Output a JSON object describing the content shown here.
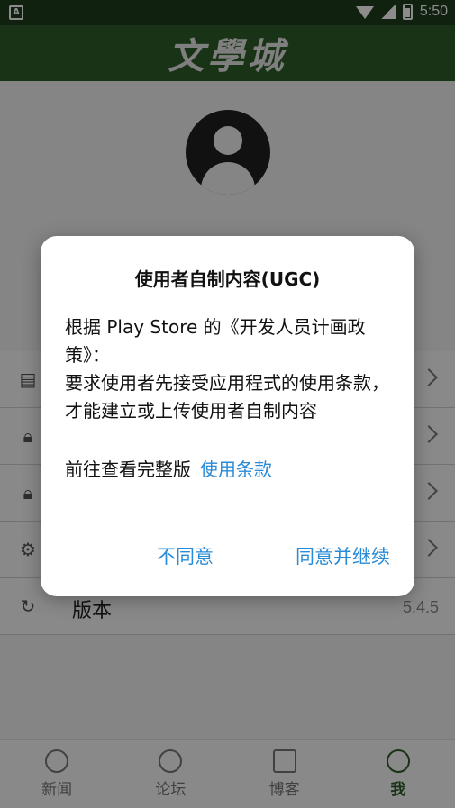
{
  "status_bar": {
    "time": "5:50",
    "left_icon": "A"
  },
  "app_bar": {
    "title": "文學城"
  },
  "menu": {
    "version_label": "版本",
    "version_value": "5.4.5"
  },
  "bottom_nav": {
    "items": [
      {
        "label": "新闻",
        "icon": "globe-icon"
      },
      {
        "label": "论坛",
        "icon": "chat-icon"
      },
      {
        "label": "博客",
        "icon": "newspaper-icon"
      },
      {
        "label": "我",
        "icon": "profile-icon"
      }
    ]
  },
  "dialog": {
    "title": "使用者自制内容(UGC)",
    "body_line1": "根据 Play Store 的《开发人员计画政策》：",
    "body_line2": "要求使用者先接受应用程式的使用条款，才能建立或上传使用者自制内容",
    "link_prefix": "前往查看完整版",
    "link_text": "使用条款",
    "decline_label": "不同意",
    "accept_label": "同意并继续"
  },
  "colors": {
    "header_green": "#2f5e28",
    "status_green": "#1f3d1c",
    "accent_blue": "#2a8bd6"
  }
}
